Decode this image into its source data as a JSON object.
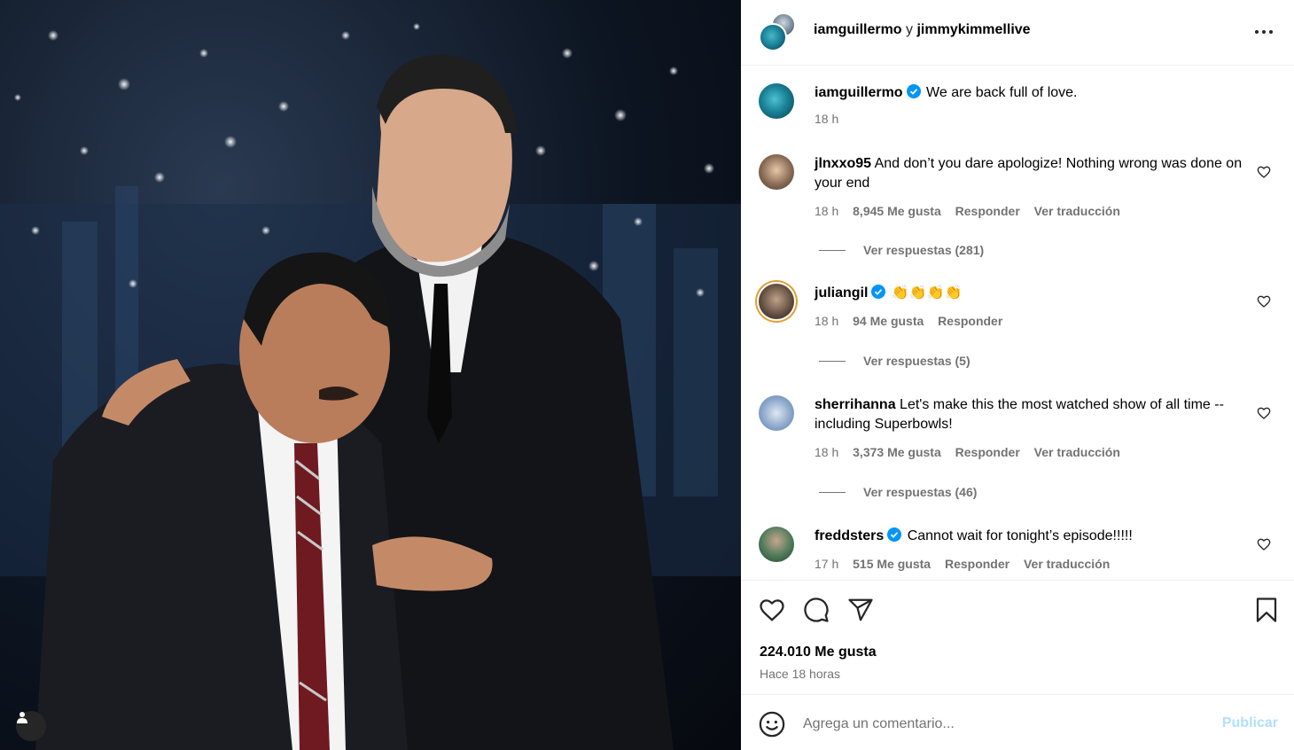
{
  "header": {
    "author": "iamguillermo",
    "connector": "y",
    "collaborator": "jimmykimmellive",
    "more_icon": "more-horizontal-icon"
  },
  "caption": {
    "username": "iamguillermo",
    "text": "We are back full of love.",
    "time": "18 h"
  },
  "comments": [
    {
      "username": "jlnxxo95",
      "text": "And don’t you dare apologize! Nothing wrong was done on your end",
      "time": "18 h",
      "likes": "8,945 Me gusta",
      "reply": "Responder",
      "translate": "Ver traducción",
      "view_replies": "Ver respuestas (281)"
    },
    {
      "username": "juliangil",
      "text": "👏👏👏👏",
      "time": "18 h",
      "likes": "94 Me gusta",
      "reply": "Responder",
      "view_replies": "Ver respuestas (5)"
    },
    {
      "username": "sherrihanna",
      "text": "Let's make this the most watched show of all time -- including Superbowls!",
      "time": "18 h",
      "likes": "3,373 Me gusta",
      "reply": "Responder",
      "translate": "Ver traducción",
      "view_replies": "Ver respuestas (46)"
    },
    {
      "username": "freddsters",
      "text": "Cannot wait for tonight’s episode!!!!!",
      "time": "17 h",
      "likes": "515 Me gusta",
      "reply": "Responder",
      "translate": "Ver traducción"
    }
  ],
  "footer": {
    "likes_total": "224.010 Me gusta",
    "posted": "Hace 18 horas",
    "comment_placeholder": "Agrega un comentario...",
    "publish_label": "Publicar"
  },
  "colors": {
    "verified": "#0095f6",
    "publish_disabled": "#b2dffc",
    "secondary_text": "#737373"
  }
}
